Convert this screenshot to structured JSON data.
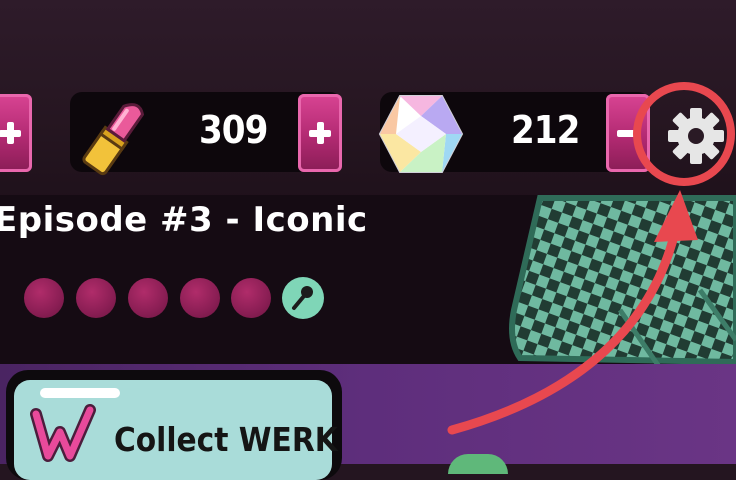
{
  "header": {
    "lipstick_count": "309",
    "gem_count": "212"
  },
  "episode": {
    "title": "Episode #3 - Iconic",
    "progress_total_dots": 6,
    "progress_note": "five dots plus a mic dot"
  },
  "collect": {
    "label": "Collect WERK"
  },
  "icons": {
    "lipstick": "lipstick-icon",
    "gem": "gem-icon",
    "settings": "gear-icon",
    "mic": "microphone-icon",
    "werk": "werk-logo-icon"
  },
  "colors": {
    "accent_pink": "#c7387f",
    "annotation_red": "#e8484f",
    "mint": "#7fd6b7",
    "card_teal": "#a9dcd9"
  }
}
